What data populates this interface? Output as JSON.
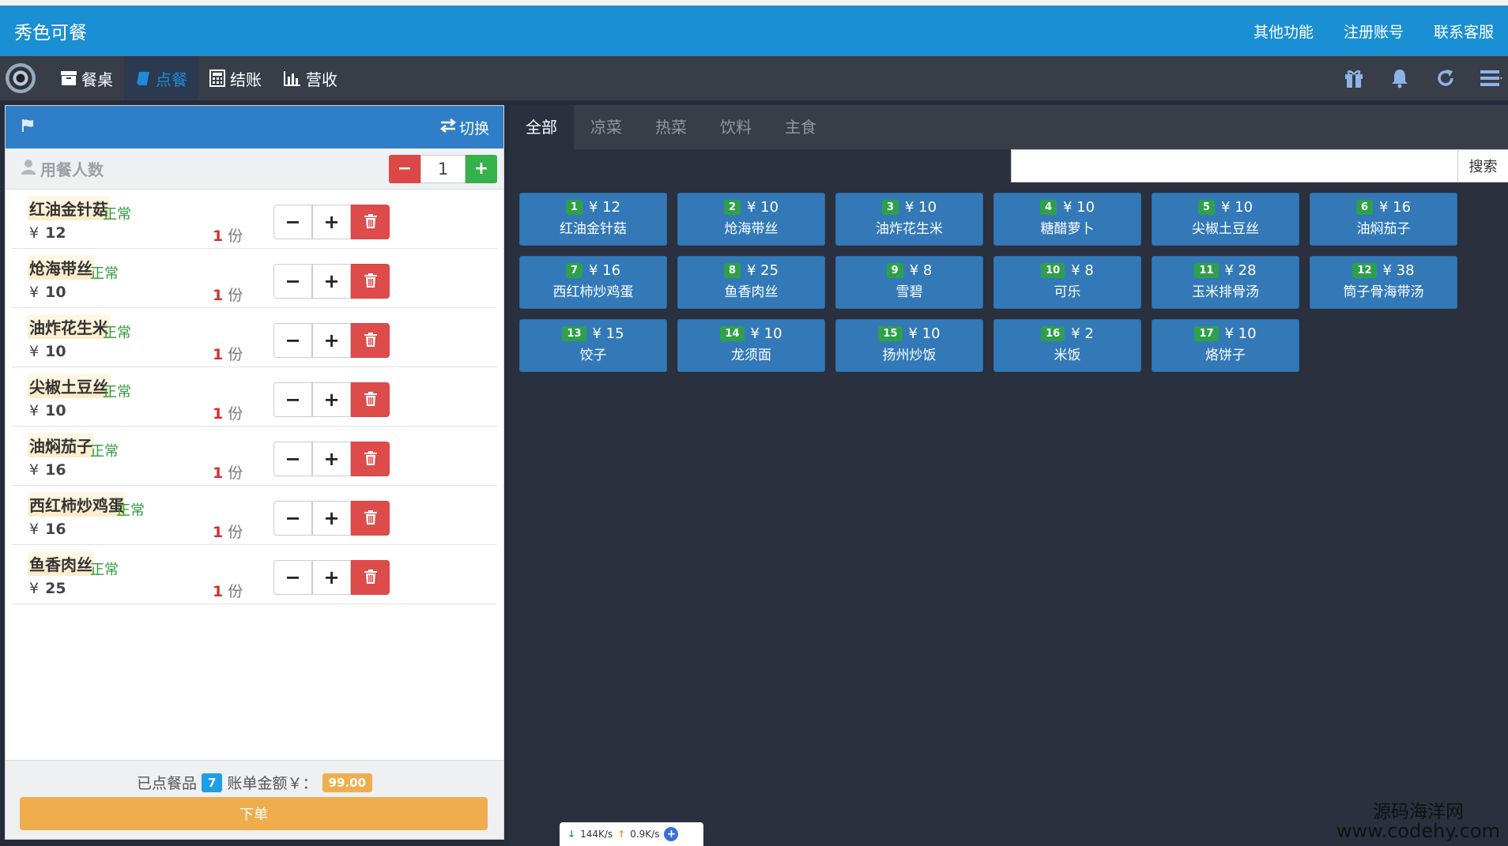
{
  "header": {
    "brand": "秀色可餐",
    "links": [
      "其他功能",
      "注册账号",
      "联系客服"
    ]
  },
  "nav": {
    "items": [
      {
        "label": "餐桌",
        "icon": "table-box-icon"
      },
      {
        "label": "点餐",
        "icon": "book-icon",
        "active": true
      },
      {
        "label": "结账",
        "icon": "calculator-icon"
      },
      {
        "label": "营收",
        "icon": "bar-chart-icon"
      }
    ],
    "right_icons": [
      "gift-icon",
      "bell-icon",
      "refresh-icon",
      "menu-list-icon"
    ]
  },
  "order_panel": {
    "switch_label": "切换",
    "people_label": "用餐人数",
    "people_count": "1",
    "items": [
      {
        "name": "红油金针菇",
        "status": "正常",
        "price": "12",
        "count": "1"
      },
      {
        "name": "炝海带丝",
        "status": "正常",
        "price": "10",
        "count": "1"
      },
      {
        "name": "油炸花生米",
        "status": "正常",
        "price": "10",
        "count": "1"
      },
      {
        "name": "尖椒土豆丝",
        "status": "正常",
        "price": "10",
        "count": "1"
      },
      {
        "name": "油焖茄子",
        "status": "正常",
        "price": "16",
        "count": "1"
      },
      {
        "name": "西红柿炒鸡蛋",
        "status": "正常",
        "price": "16",
        "count": "1"
      },
      {
        "name": "鱼香肉丝",
        "status": "正常",
        "price": "25",
        "count": "1"
      }
    ],
    "currency": "¥",
    "unit": "份",
    "summary_ordered_label": "已点餐品",
    "summary_ordered_count": "7",
    "summary_amount_label": "账单金额￥：",
    "summary_amount": "99.00",
    "submit_label": "下单"
  },
  "menu": {
    "tabs": [
      "全部",
      "凉菜",
      "热菜",
      "饮料",
      "主食"
    ],
    "active_tab": 0,
    "search_placeholder": "",
    "search_button": "搜索",
    "dishes": [
      {
        "num": "1",
        "price": "¥ 12",
        "name": "红油金针菇"
      },
      {
        "num": "2",
        "price": "¥ 10",
        "name": "炝海带丝"
      },
      {
        "num": "3",
        "price": "¥ 10",
        "name": "油炸花生米"
      },
      {
        "num": "4",
        "price": "¥ 10",
        "name": "糖醋萝卜"
      },
      {
        "num": "5",
        "price": "¥ 10",
        "name": "尖椒土豆丝"
      },
      {
        "num": "6",
        "price": "¥ 16",
        "name": "油焖茄子"
      },
      {
        "num": "7",
        "price": "¥ 16",
        "name": "西红柿炒鸡蛋"
      },
      {
        "num": "8",
        "price": "¥ 25",
        "name": "鱼香肉丝"
      },
      {
        "num": "9",
        "price": "¥ 8",
        "name": "雪碧"
      },
      {
        "num": "10",
        "price": "¥ 8",
        "name": "可乐"
      },
      {
        "num": "11",
        "price": "¥ 28",
        "name": "玉米排骨汤"
      },
      {
        "num": "12",
        "price": "¥ 38",
        "name": "筒子骨海带汤"
      },
      {
        "num": "13",
        "price": "¥ 15",
        "name": "饺子"
      },
      {
        "num": "14",
        "price": "¥ 10",
        "name": "龙须面"
      },
      {
        "num": "15",
        "price": "¥ 10",
        "name": "扬州炒饭"
      },
      {
        "num": "16",
        "price": "¥ 2",
        "name": "米饭"
      },
      {
        "num": "17",
        "price": "¥ 10",
        "name": "烙饼子"
      }
    ]
  },
  "netspeed": {
    "down": "144K/s",
    "up": "0.9K/s"
  },
  "watermark": {
    "line1": "源码海洋网",
    "line2": "www.codehy.com"
  },
  "colors": {
    "topbar": "#1b8fd3",
    "navbar": "#383d48",
    "dish": "#3379b8",
    "delete": "#de4b4b",
    "submit": "#f0ad4e",
    "status": "#2f9a3c"
  }
}
